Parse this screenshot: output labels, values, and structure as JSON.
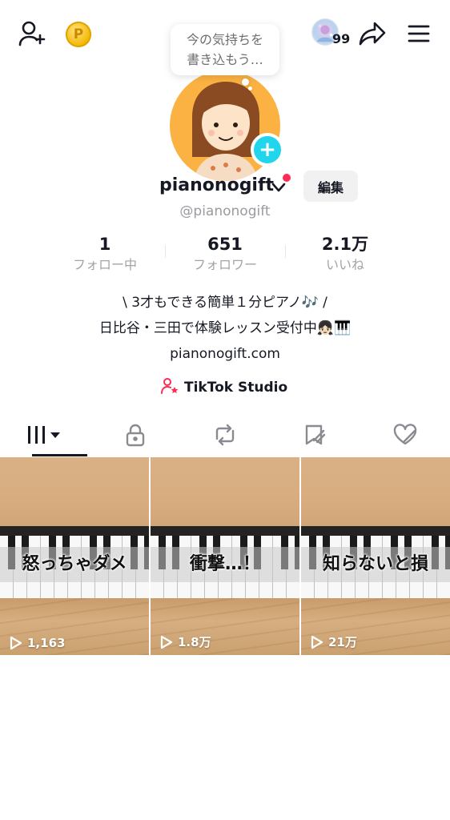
{
  "header": {
    "story_count": "99",
    "bubble_line1": "今の気持ちを",
    "bubble_line2": "書き込もう…"
  },
  "profile": {
    "username": "pianonogift",
    "handle": "@pianonogift",
    "edit_label": "編集",
    "stats": [
      {
        "value": "1",
        "label": "フォロー中"
      },
      {
        "value": "651",
        "label": "フォロワー"
      },
      {
        "value": "2.1万",
        "label": "いいね"
      }
    ],
    "bio_line1": "\\ 3才もできる簡単１分ピアノ🎶 /",
    "bio_line2": "日比谷・三田で体験レッスン受付中👧🏻🎹",
    "link": "pianonogift.com",
    "studio_label": "TikTok Studio"
  },
  "tabs": [
    {
      "name": "videos",
      "icon": "grid-lines-icon",
      "active": true
    },
    {
      "name": "private",
      "icon": "lock-icon"
    },
    {
      "name": "reposts",
      "icon": "repost-icon"
    },
    {
      "name": "favorites",
      "icon": "bookmark-icon"
    },
    {
      "name": "liked",
      "icon": "heart-icon"
    }
  ],
  "videos": [
    {
      "caption": "怒っちゃダメ",
      "views": "1,163"
    },
    {
      "caption": "衝撃…！",
      "views": "1.8万"
    },
    {
      "caption": "知らないと損",
      "views": "21万"
    }
  ],
  "colors": {
    "accent_red": "#fe2c55",
    "accent_cyan": "#20d5ec",
    "avatar_bg": "#fbb243"
  }
}
